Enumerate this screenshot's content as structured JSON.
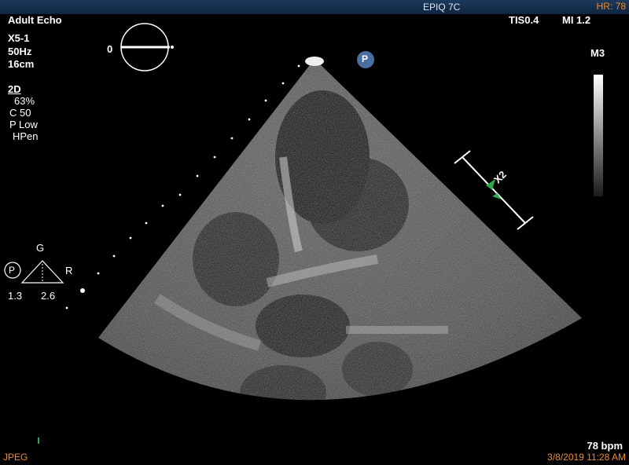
{
  "topbar": {
    "system": "EPIQ 7C",
    "heart_rate": "HR: 78"
  },
  "header_left": {
    "preset": "Adult Echo",
    "probe": "X5-1",
    "frame_rate": "50Hz",
    "depth": "16cm",
    "orientation_marker": "0"
  },
  "mode_panel": {
    "mode": "2D",
    "gain": "63%",
    "compression": "C 50",
    "power": "P Low",
    "harmonics": "HPen"
  },
  "header_right": {
    "tis": "TIS0.4",
    "mi": "MI 1.2",
    "map": "M3"
  },
  "gain_indicator": {
    "label_p": "P",
    "label_g": "G",
    "label_r": "R",
    "value_left": "1.3",
    "value_right": "2.6"
  },
  "focus": {
    "label": "X2"
  },
  "probe_badge": {
    "label": "P"
  },
  "footer": {
    "bpm": "78 bpm",
    "format": "JPEG",
    "timestamp": "3/8/2019 11:28 AM"
  },
  "colors": {
    "accent_orange": "#f08a2a",
    "topbar": "#1c3a5c",
    "focus_marker": "#2fa84f"
  }
}
